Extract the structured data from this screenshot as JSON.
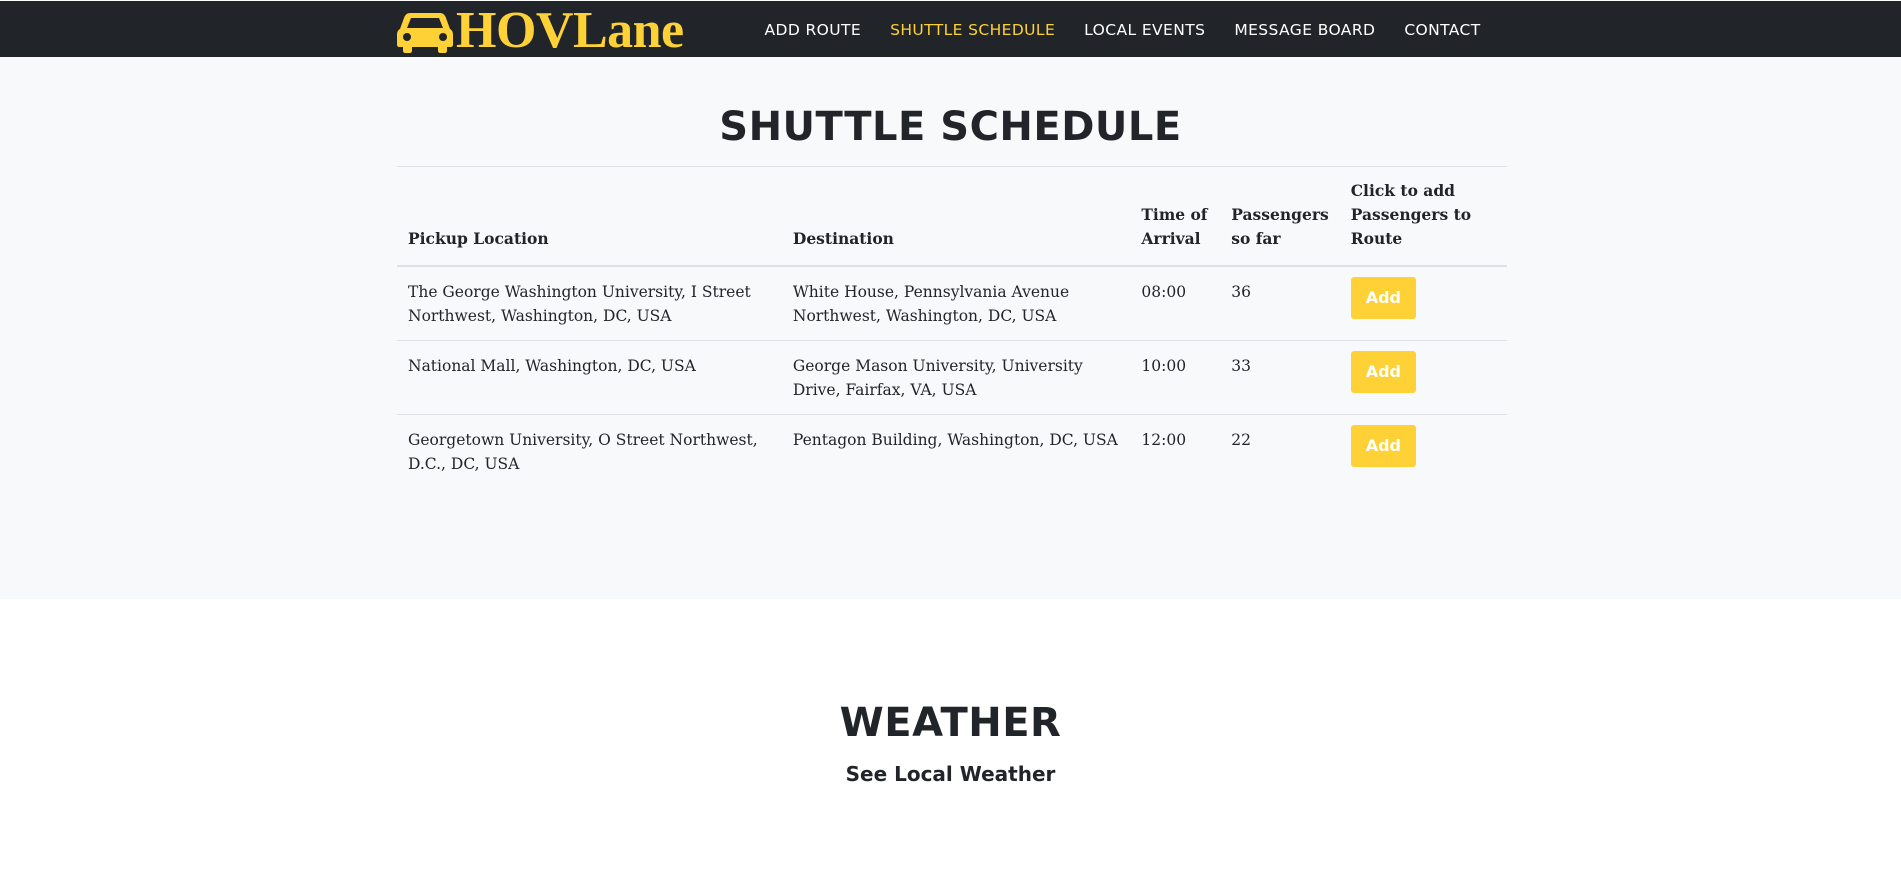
{
  "brand": {
    "name": "HOVLane",
    "icon": "car-icon",
    "color": "#fed136"
  },
  "nav": {
    "items": [
      {
        "label": "ADD ROUTE",
        "active": false
      },
      {
        "label": "SHUTTLE SCHEDULE",
        "active": true
      },
      {
        "label": "LOCAL EVENTS",
        "active": false
      },
      {
        "label": "MESSAGE BOARD",
        "active": false
      },
      {
        "label": "CONTACT",
        "active": false
      }
    ]
  },
  "schedule": {
    "title": "SHUTTLE SCHEDULE",
    "headers": {
      "pickup": "Pickup Location",
      "destination": "Destination",
      "time": "Time of Arrival",
      "passengers": "Passengers so far",
      "action": "Click to add Passengers to Route"
    },
    "rows": [
      {
        "pickup": "The George Washington University, I Street Northwest, Washington, DC, USA",
        "destination": "White House, Pennsylvania Avenue Northwest, Washington, DC, USA",
        "time": "08:00",
        "passengers": "36",
        "button": "Add"
      },
      {
        "pickup": "National Mall, Washington, DC, USA",
        "destination": "George Mason University, University Drive, Fairfax, VA, USA",
        "time": "10:00",
        "passengers": "33",
        "button": "Add"
      },
      {
        "pickup": "Georgetown University, O Street Northwest, D.C., DC, USA",
        "destination": "Pentagon Building, Washington, DC, USA",
        "time": "12:00",
        "passengers": "22",
        "button": "Add"
      }
    ]
  },
  "weather": {
    "title": "WEATHER",
    "subtitle": "See Local Weather"
  },
  "colors": {
    "accent": "#fed136",
    "navbar": "#212529",
    "section_bg": "#f8f9fa"
  }
}
